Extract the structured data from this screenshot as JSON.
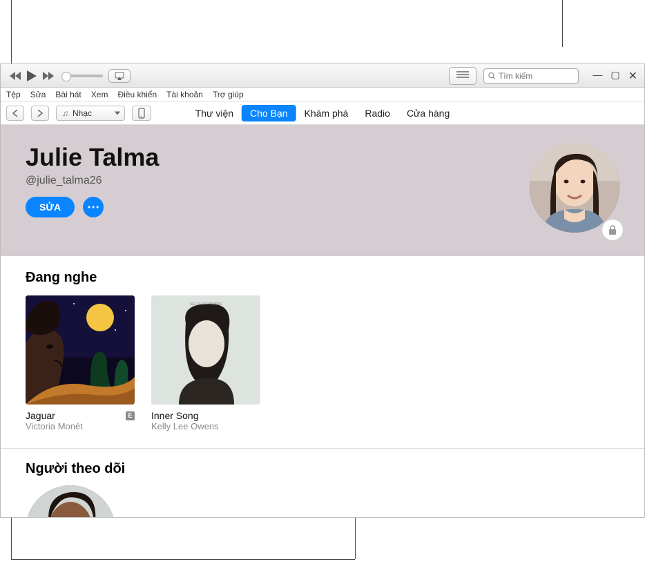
{
  "menubar": [
    "Tệp",
    "Sửa",
    "Bài hát",
    "Xem",
    "Điều khiển",
    "Tài khoản",
    "Trợ giúp"
  ],
  "dropdown_label": "Nhạc",
  "tabs": {
    "items": [
      "Thư viện",
      "Cho Bạn",
      "Khám phá",
      "Radio",
      "Cửa hàng"
    ],
    "active_index": 1
  },
  "search": {
    "placeholder": "Tìm kiếm"
  },
  "profile": {
    "name": "Julie Talma",
    "handle": "@julie_talma26",
    "edit_label": "SỬA"
  },
  "sections": {
    "listening": {
      "title": "Đang nghe",
      "albums": [
        {
          "title": "Jaguar",
          "artist": "Victoria Monét",
          "explicit": true
        },
        {
          "title": "Inner Song",
          "artist": "Kelly Lee Owens",
          "explicit": false
        }
      ]
    },
    "followers": {
      "title": "Người theo dõi"
    }
  },
  "explicit_badge": "E"
}
